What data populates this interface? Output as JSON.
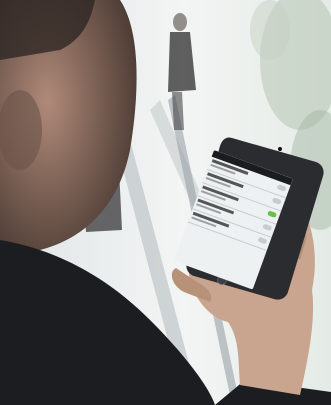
{
  "scene": {
    "colors": {
      "background": "#f4f6f5",
      "jacket": "#1c1d20",
      "skin": "#c9a58f",
      "phone_body": "#2a2c30",
      "phone_screen": "#eef1f2",
      "toggle_on": "#6cc04a"
    },
    "phone": {
      "rows": [
        {
          "toggle_on": false
        },
        {
          "toggle_on": false
        },
        {
          "toggle_on": true
        },
        {
          "toggle_on": false
        },
        {
          "toggle_on": false
        }
      ]
    }
  }
}
